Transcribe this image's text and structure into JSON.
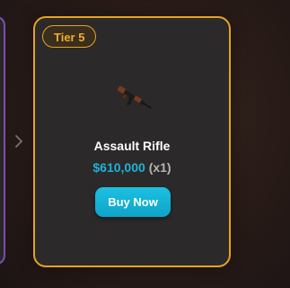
{
  "carousel": {
    "prev_arrow_icon": "chevron-right-icon"
  },
  "card": {
    "tier_label": "Tier 5",
    "item_icon": "assault-rifle-icon",
    "item_name": "Assault Rifle",
    "price": "$610,000",
    "quantity": "(x1)",
    "buy_label": "Buy Now"
  },
  "colors": {
    "tier_accent": "#e8a21e",
    "price": "#1fb3d6",
    "button": "#12add2",
    "prev_card_border": "#7a4fb0",
    "card_bg": "#2b2929"
  }
}
